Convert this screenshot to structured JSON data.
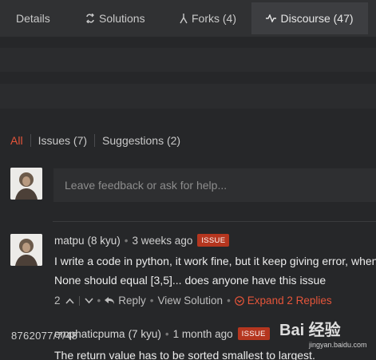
{
  "tabs": {
    "details": "Details",
    "solutions": "Solutions",
    "forks": "Forks (4)",
    "discourse": "Discourse (47)"
  },
  "filters": {
    "all": "All",
    "issues": "Issues (7)",
    "suggestions": "Suggestions (2)"
  },
  "feedback": {
    "placeholder": "Leave feedback or ask for help..."
  },
  "comments": [
    {
      "user": "matpu",
      "rank": "(8 kyu)",
      "time": "3 weeks ago",
      "badge": "ISSUE",
      "line1": "I write a code in python, it work fine, but it keep giving error, when I",
      "line2": "None should equal [3,5]... does anyone have this issue",
      "votes": "2",
      "reply": "Reply",
      "view_solution": "View Solution",
      "expand": "Expand 2 Replies"
    },
    {
      "user": "emphaticpuma",
      "rank": "(7 kyu)",
      "time": "1 month ago",
      "badge": "ISSUE",
      "line1": "The return value has to be sorted smallest to largest."
    }
  ],
  "overlay_id": "8762077/7/48",
  "watermark": {
    "brand": "Bai 经验",
    "url": "jingyan.baidu.com"
  },
  "colors": {
    "accent": "#e5553a",
    "badge": "#b5361f",
    "background": "#262729"
  }
}
